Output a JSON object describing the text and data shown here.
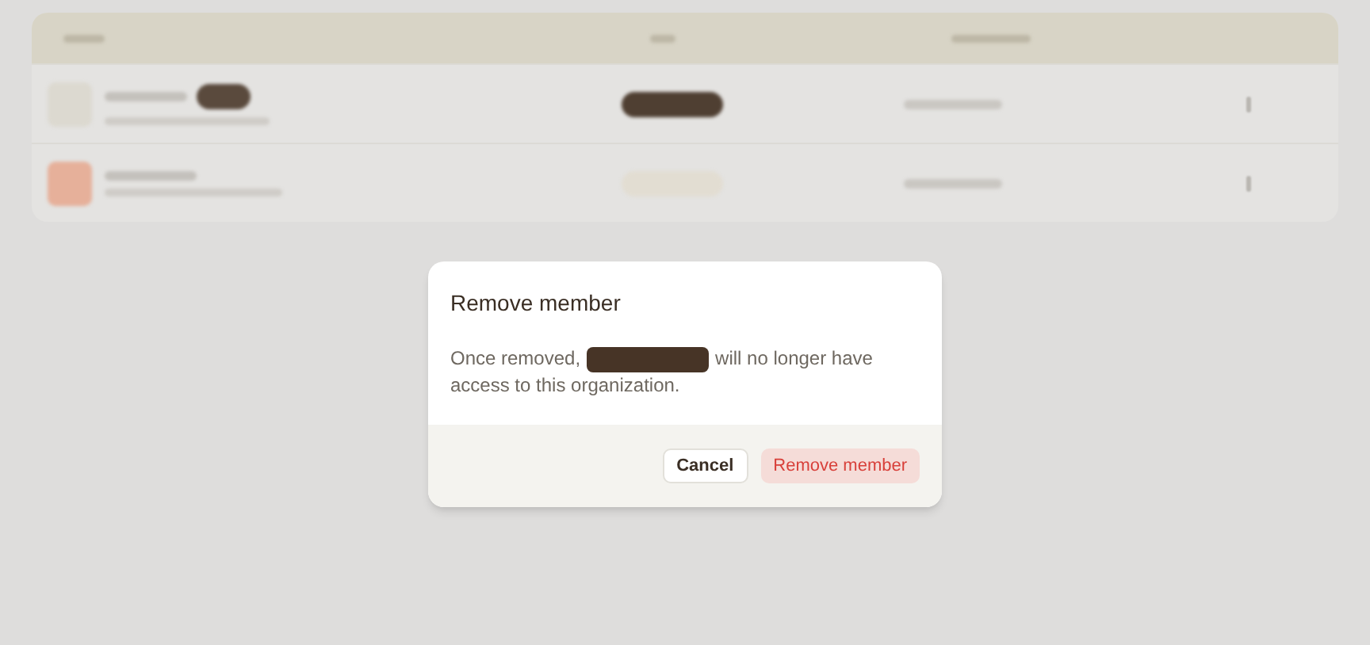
{
  "backdrop": {
    "rows": [
      {
        "kind": "primary"
      },
      {
        "kind": "plain"
      }
    ]
  },
  "dialog": {
    "title": "Remove member",
    "message": [
      "Once removed,",
      "will no longer have",
      "access to this organization."
    ],
    "buttons": [
      {
        "label": "Cancel",
        "kind": "secondary"
      },
      {
        "label": "Remove member",
        "kind": "danger"
      }
    ]
  }
}
